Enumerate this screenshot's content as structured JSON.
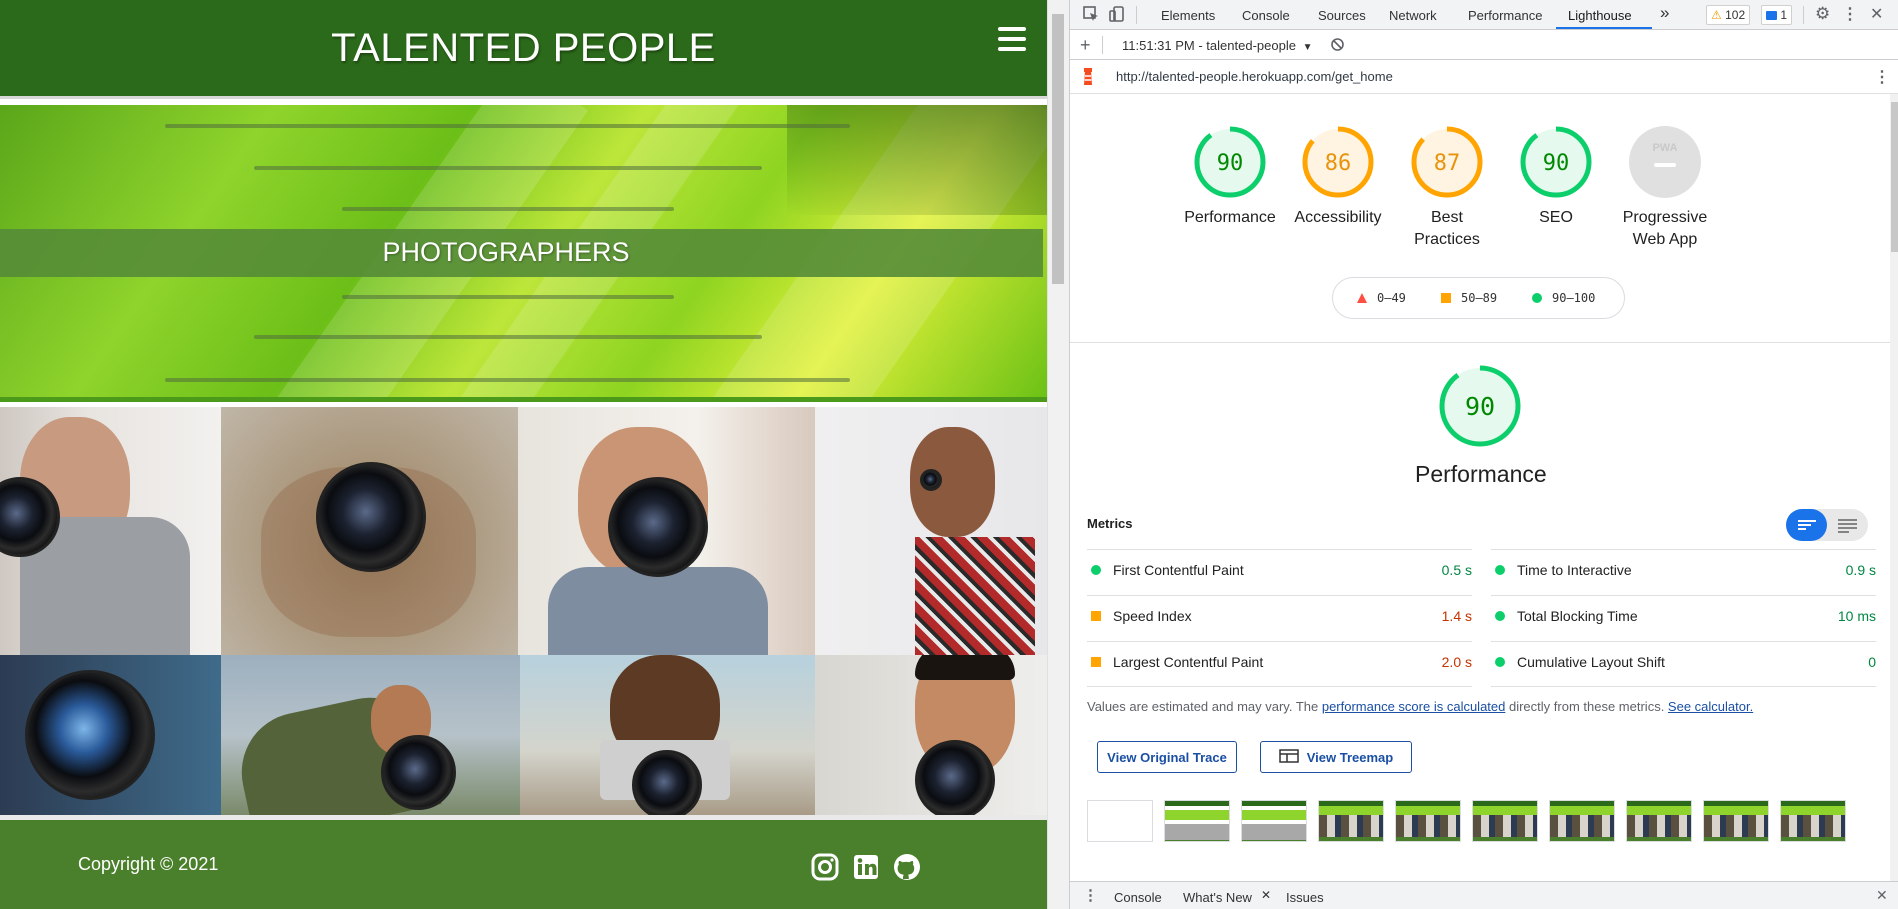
{
  "site": {
    "title": "TALENTED PEOPLE",
    "hero_label": "PHOTOGRAPHERS",
    "copyright": "Copyright © 2021",
    "social_icons": [
      "instagram-icon",
      "linkedin-icon",
      "github-icon"
    ],
    "colors": {
      "header": "#2b6a1a",
      "footer": "#4a7f2b",
      "hero": "#8fd42c"
    }
  },
  "devtools": {
    "tabs": [
      "Elements",
      "Console",
      "Sources",
      "Network",
      "Performance",
      "Lighthouse"
    ],
    "active_tab": "Lighthouse",
    "more_tabs": "»",
    "warnings_count": "102",
    "messages_count": "1",
    "report_selector": "11:51:31 PM - talented-people",
    "url": "http://talented-people.herokuapp.com/get_home",
    "scores": [
      {
        "label": "Performance",
        "score": "90",
        "color": "#0cce6b"
      },
      {
        "label": "Accessibility",
        "score": "86",
        "color": "#ffa400"
      },
      {
        "label": "Best Practices",
        "score": "87",
        "color": "#ffa400"
      },
      {
        "label": "SEO",
        "score": "90",
        "color": "#0cce6b"
      },
      {
        "label": "Progressive Web App",
        "score": "",
        "color": "#cccccc"
      }
    ],
    "legend": [
      {
        "range": "0–49",
        "shape": "triangle",
        "color": "#ff4e42"
      },
      {
        "range": "50–89",
        "shape": "square",
        "color": "#ffa400"
      },
      {
        "range": "90–100",
        "shape": "circle",
        "color": "#0cce6b"
      }
    ],
    "perf_section": {
      "score": "90",
      "title": "Performance"
    },
    "metrics_title": "Metrics",
    "metrics": [
      {
        "name": "First Contentful Paint",
        "value": "0.5 s",
        "status": "pass"
      },
      {
        "name": "Time to Interactive",
        "value": "0.9 s",
        "status": "pass"
      },
      {
        "name": "Speed Index",
        "value": "1.4 s",
        "status": "average"
      },
      {
        "name": "Total Blocking Time",
        "value": "10 ms",
        "status": "pass"
      },
      {
        "name": "Largest Contentful Paint",
        "value": "2.0 s",
        "status": "average"
      },
      {
        "name": "Cumulative Layout Shift",
        "value": "0",
        "status": "pass"
      }
    ],
    "note": {
      "text_1": "Values are estimated and may vary. The ",
      "link_1": "performance score is calculated",
      "text_2": " directly from these metrics. ",
      "link_2": "See calculator."
    },
    "buttons": {
      "trace": "View Original Trace",
      "treemap": "View Treemap"
    },
    "drawer_tabs": [
      "Console",
      "What's New",
      "Issues"
    ]
  }
}
